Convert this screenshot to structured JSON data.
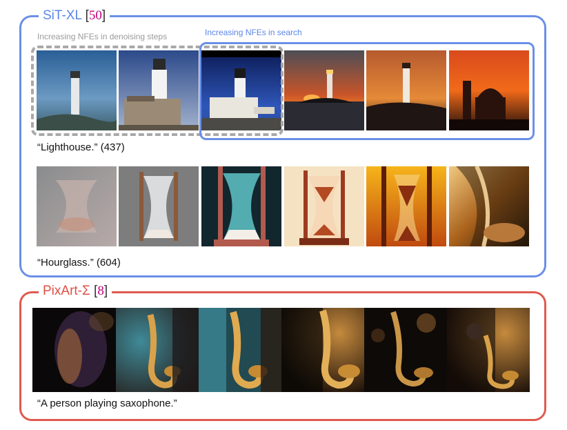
{
  "sit_panel": {
    "name": "SiT-XL",
    "cite_open": "[",
    "cite_num": "50",
    "cite_close": "]",
    "note_denoising": "Increasing NFEs in denoising steps",
    "note_search": "Increasing NFEs in search",
    "rows": [
      {
        "caption": "“Lighthouse.” (437)"
      },
      {
        "caption": "“Hourglass.” (604)"
      }
    ]
  },
  "pix_panel": {
    "name": "PixArt-Σ",
    "cite_open": "[",
    "cite_num": "8",
    "cite_close": "]",
    "caption": "“A person playing saxophone.”"
  },
  "colors": {
    "sit_accent": "#5b86e8",
    "pix_accent": "#df4e44",
    "denoise_box": "#a9a9a9",
    "citation": "#c0007a"
  }
}
